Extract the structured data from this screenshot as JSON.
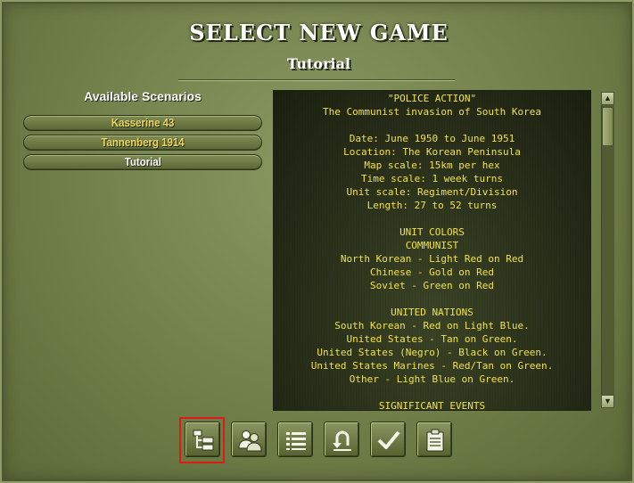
{
  "header": {
    "title": "SELECT NEW GAME",
    "subtitle": "Tutorial"
  },
  "scenarios": {
    "heading": "Available Scenarios",
    "items": [
      {
        "label": "Kasserine 43",
        "color": "#f0d860"
      },
      {
        "label": "Tannenberg 1914",
        "color": "#f0d860"
      },
      {
        "label": "Tutorial",
        "color": "#ffffff",
        "selected": true
      }
    ]
  },
  "description": {
    "lines": [
      "\"POLICE ACTION\"",
      "The Communist invasion of South Korea",
      "",
      "Date: June 1950 to June 1951",
      "Location: The Korean Peninsula",
      "Map scale: 15km per hex",
      "Time scale: 1 week turns",
      "Unit scale: Regiment/Division",
      "Length: 27 to 52 turns",
      "",
      "UNIT COLORS",
      "COMMUNIST",
      "North Korean - Light Red on Red",
      "Chinese - Gold on Red",
      "Soviet - Green on Red",
      "",
      "UNITED NATIONS",
      "South Korean - Red on Light Blue.",
      "United States - Tan on Green.",
      "United States (Negro) - Black on Green.",
      "United States Marines - Red/Tan on Green.",
      "Other - Light Blue on Green.",
      "",
      "SIGNIFICANT EVENTS"
    ],
    "text_color": "#f2e24a"
  },
  "toolbar": {
    "buttons": [
      {
        "icon": "scenario-tree-icon",
        "highlighted": true
      },
      {
        "icon": "players-icon"
      },
      {
        "icon": "list-icon"
      },
      {
        "icon": "return-icon"
      },
      {
        "icon": "checkmark-icon"
      },
      {
        "icon": "clipboard-icon"
      }
    ],
    "highlight_color": "#e01818"
  }
}
